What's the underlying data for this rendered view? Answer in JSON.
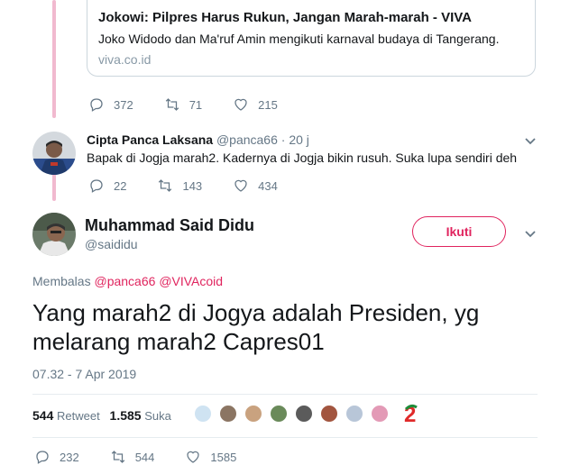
{
  "link_card": {
    "title": "Jokowi: Pilpres Harus Rukun, Jangan Marah-marah - VIVA",
    "description": "Joko Widodo dan Ma'ruf Amin mengikuti karnaval budaya di Tangerang.",
    "domain": "viva.co.id"
  },
  "first_tweet_actions": {
    "replies": "372",
    "retweets": "71",
    "likes": "215"
  },
  "reply_tweet": {
    "name": "Cipta Panca Laksana",
    "handle": "@panca66",
    "separator": "·",
    "time": "20 j",
    "text": "Bapak di Jogja marah2. Kadernya di Jogja bikin rusuh. Suka lupa sendiri deh",
    "replies": "22",
    "retweets": "143",
    "likes": "434"
  },
  "main_tweet": {
    "name": "Muhammad Said Didu",
    "handle": "@saididu",
    "follow_label": "Ikuti",
    "replying_label": "Membalas",
    "replying_to": [
      "@panca66",
      "@VIVAcoid"
    ],
    "text": "Yang marah2 di Jogya adalah Presiden, yg melarang marah2 Capres01",
    "timestamp": "07.32 - 7 Apr 2019",
    "retweet_count": "544",
    "retweet_label": "Retweet",
    "like_count": "1.585",
    "like_label": "Suka",
    "replies": "232",
    "retweets": "544",
    "likes": "1585"
  },
  "icons": {
    "reply": "reply-icon",
    "retweet": "retweet-icon",
    "like": "heart-icon",
    "menu": "chevron-down-icon"
  },
  "colors": {
    "accent": "#e0245e",
    "thread_line": "#f1b9cf",
    "muted": "#657786",
    "border": "#ccd6dd"
  }
}
